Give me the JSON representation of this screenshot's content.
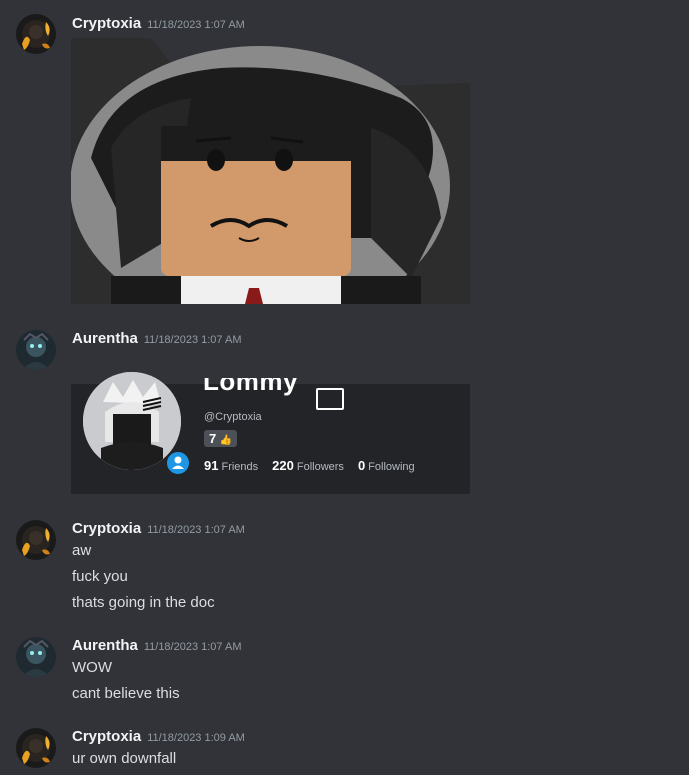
{
  "messages": [
    {
      "username": "Cryptoxia",
      "timestamp": "11/18/2023 1:07 AM",
      "avatar_icon": "dark-flame-avatar",
      "attachment": "roblox-avatar-headshot-image"
    },
    {
      "username": "Aurentha",
      "timestamp": "11/18/2023 1:07 AM",
      "avatar_icon": "dark-blue-avatar",
      "embed": {
        "display_name": "Lommy",
        "handle": "@Cryptoxia",
        "badge_count": "7",
        "friends_count": "91",
        "friends_label": "Friends",
        "followers_count": "220",
        "followers_label": "Followers",
        "following_count": "0",
        "following_label": "Following"
      }
    },
    {
      "username": "Cryptoxia",
      "timestamp": "11/18/2023 1:07 AM",
      "avatar_icon": "dark-flame-avatar",
      "lines": [
        "aw",
        "fuck you",
        "thats going in the doc"
      ]
    },
    {
      "username": "Aurentha",
      "timestamp": "11/18/2023 1:07 AM",
      "avatar_icon": "dark-blue-avatar",
      "lines": [
        "WOW",
        "cant believe this"
      ]
    },
    {
      "username": "Cryptoxia",
      "timestamp": "11/18/2023 1:09 AM",
      "avatar_icon": "dark-flame-avatar",
      "lines": [
        "ur own downfall"
      ]
    }
  ],
  "colors": {
    "background": "#313338",
    "username": "#f2f3f5",
    "timestamp": "#949ba4",
    "text": "#dbdee1",
    "accent_blue": "#1e96e6"
  }
}
